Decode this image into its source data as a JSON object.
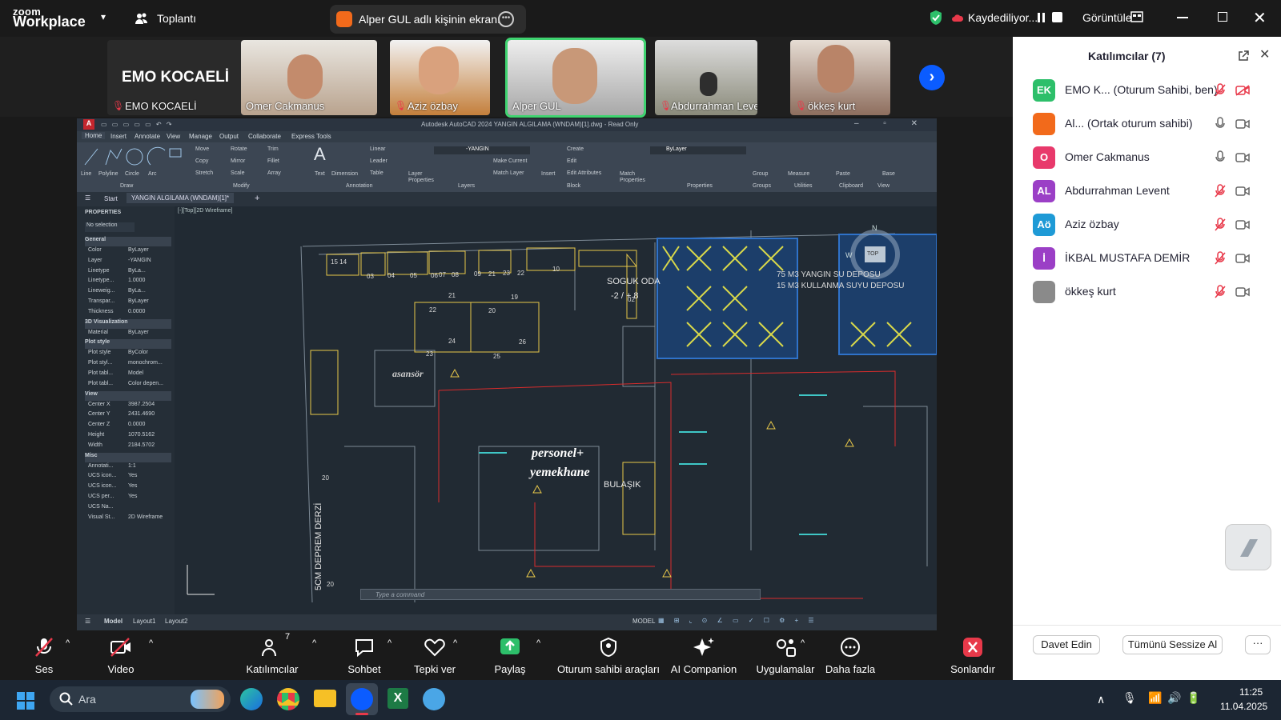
{
  "app": {
    "brand_line1": "zoom",
    "brand_line2": "Workplace",
    "meeting_menu": "Toplantı"
  },
  "share_pill": {
    "label": "Alper GUL adlı kişinin ekranı"
  },
  "recording": {
    "label": "Kaydediliyor..."
  },
  "view_menu": {
    "label": "Görüntüle"
  },
  "thumbnails": [
    {
      "name": "EMO KOCAELİ",
      "muted": true,
      "big_label": "EMO KOCAELİ"
    },
    {
      "name": "Omer Cakmanus",
      "muted": false
    },
    {
      "name": "Aziz özbay",
      "muted": true
    },
    {
      "name": "Alper GUL",
      "muted": false,
      "active": true
    },
    {
      "name": "Abdurrahman Levent",
      "muted": true
    },
    {
      "name": "ökkeş kurt",
      "muted": true
    }
  ],
  "autocad": {
    "title": "Autodesk AutoCAD 2024   YANGIN ALGILAMA (WNDAM)[1].dwg - Read Only",
    "tabs": [
      "Home",
      "Insert",
      "Annotate",
      "View",
      "Manage",
      "Output",
      "Collaborate",
      "Express Tools"
    ],
    "ribbon_groups": [
      "Draw",
      "Modify",
      "Annotation",
      "Layers",
      "Block",
      "Properties",
      "Groups",
      "Utilities",
      "Clipboard",
      "View"
    ],
    "ribbon_tools": [
      "Line",
      "Polyline",
      "Circle",
      "Arc",
      "Move",
      "Rotate",
      "Trim",
      "Copy",
      "Mirror",
      "Fillet",
      "Stretch",
      "Scale",
      "Array",
      "Text",
      "Dimension",
      "Linear",
      "Leader",
      "Table",
      "Layer Properties",
      "Make Current",
      "Match Layer",
      "Insert",
      "Create",
      "Edit",
      "Edit Attributes",
      "Match Properties",
      "ByLayer",
      "Group",
      "Measure",
      "Paste",
      "Base"
    ],
    "layer_name": "-YANGIN",
    "file_tabs": [
      "Start",
      "YANGIN ALGILAMA (WNDAM)[1]*"
    ],
    "viewport_label": "[-][Top][2D Wireframe]",
    "props_title": "PROPERTIES",
    "selection": "No selection",
    "props_sections": [
      {
        "title": "General",
        "rows": [
          [
            "Color",
            "ByLayer"
          ],
          [
            "Layer",
            "-YANGIN"
          ],
          [
            "Linetype",
            "ByLa..."
          ],
          [
            "Linetype...",
            "1.0000"
          ],
          [
            "Lineweig...",
            "ByLa..."
          ],
          [
            "Transpar...",
            "ByLayer"
          ],
          [
            "Thickness",
            "0.0000"
          ]
        ]
      },
      {
        "title": "3D Visualization",
        "rows": [
          [
            "Material",
            "ByLayer"
          ]
        ]
      },
      {
        "title": "Plot style",
        "rows": [
          [
            "Plot style",
            "ByColor"
          ],
          [
            "Plot styl...",
            "monochrom..."
          ],
          [
            "Plot tabl...",
            "Model"
          ],
          [
            "Plot tabl...",
            "Color depen..."
          ]
        ]
      },
      {
        "title": "View",
        "rows": [
          [
            "Center X",
            "3987.2504"
          ],
          [
            "Center Y",
            "2431.4690"
          ],
          [
            "Center Z",
            "0.0000"
          ],
          [
            "Height",
            "1070.5162"
          ],
          [
            "Width",
            "2184.5702"
          ]
        ]
      },
      {
        "title": "Misc",
        "rows": [
          [
            "Annotati...",
            "1:1"
          ],
          [
            "UCS icon...",
            "Yes"
          ],
          [
            "UCS icon...",
            "Yes"
          ],
          [
            "UCS per...",
            "Yes"
          ],
          [
            "UCS Na...",
            ""
          ],
          [
            "Visual St...",
            "2D Wireframe"
          ]
        ]
      }
    ],
    "drawing_labels": {
      "soguk": "SOGUK ODA",
      "soguk_temp": "-2 / + 8",
      "asansor": "asansör",
      "personel1": "personel+",
      "personel2": "yemekhane",
      "bulasik": "BULAŞIK",
      "deprem": "5CM DEPREM DERZİ",
      "depo1": "75 M3  YANGIN SU DEPOSU",
      "depo2": "15 M3  KULLANMA SUYU DEPOSU",
      "compass_n": "N",
      "compass_w": "W",
      "compass_top": "TOP",
      "nums": [
        "03",
        "04",
        "05",
        "06",
        "07",
        "08",
        "09",
        "21",
        "23",
        "22",
        "10",
        "21",
        "19",
        "22",
        "20",
        "24",
        "26",
        "25",
        "23",
        "20",
        "20",
        "02",
        "15 14"
      ]
    },
    "command_placeholder": "Type a command",
    "layout_tabs": [
      "Model",
      "Layout1",
      "Layout2"
    ],
    "status_model": "MODEL"
  },
  "panel": {
    "title": "Katılımcılar (7)",
    "participants": [
      {
        "initials": "EK",
        "color": "#2dbf6a",
        "name": "EMO K...   (Oturum Sahibi, ben)",
        "mic": "muted",
        "video": "off"
      },
      {
        "initials": "",
        "color": "#f26a1b",
        "name": "Al...   (Ortak oturum sahibi)",
        "mic": "on",
        "video": "on"
      },
      {
        "initials": "O",
        "color": "#e8396b",
        "name": "Omer Cakmanus",
        "mic": "on",
        "video": "on"
      },
      {
        "initials": "AL",
        "color": "#9b3fc6",
        "name": "Abdurrahman Levent",
        "mic": "muted",
        "video": "on"
      },
      {
        "initials": "Aö",
        "color": "#1e9ad6",
        "name": "Aziz özbay",
        "mic": "muted",
        "video": "on"
      },
      {
        "initials": "İ",
        "color": "#9b3fc6",
        "name": "İKBAL MUSTAFA DEMİR",
        "mic": "muted",
        "video": "on"
      },
      {
        "initials": "",
        "color": "#8a8a8a",
        "name": "ökkeş kurt",
        "mic": "muted",
        "video": "on"
      }
    ],
    "invite": "Davet Edin",
    "mute_all": "Tümünü Sessize Al",
    "more": "···"
  },
  "toolbar": {
    "audio": "Ses",
    "video": "Video",
    "participants": "Katılımcılar",
    "participants_count": "7",
    "chat": "Sohbet",
    "react": "Tepki ver",
    "share": "Paylaş",
    "host_tools": "Oturum sahibi araçları",
    "ai": "AI Companion",
    "apps": "Uygulamalar",
    "more": "Daha fazla",
    "end": "Sonlandır"
  },
  "taskbar": {
    "search_placeholder": "Ara",
    "time": "11:25",
    "date": "11.04.2025"
  }
}
